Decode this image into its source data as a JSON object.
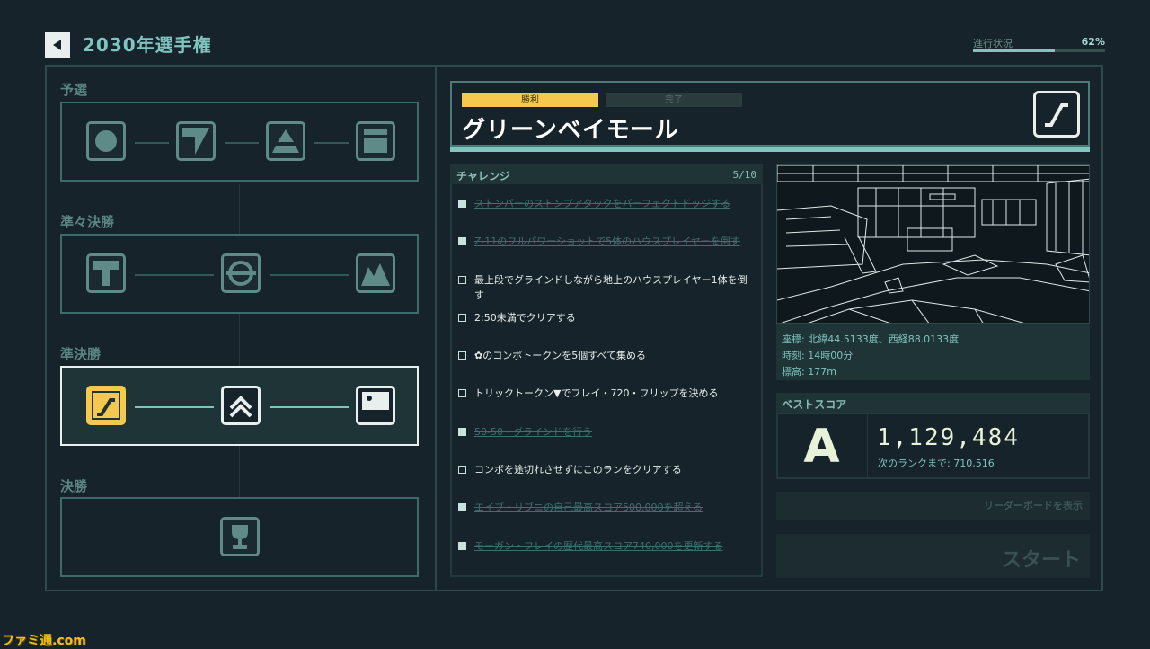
{
  "header": {
    "title": "2030年選手権",
    "progress_label": "進行状況",
    "progress_value": "62%",
    "progress_fraction": 0.62
  },
  "rounds": [
    {
      "label": "予選",
      "icons": [
        "circle-stage-icon",
        "slope-stage-icon",
        "pyramid-stage-icon",
        "box-stage-icon"
      ]
    },
    {
      "label": "準々決勝",
      "icons": [
        "hammer-stage-icon",
        "ring-stage-icon",
        "mountain-stage-icon"
      ]
    },
    {
      "label": "準決勝",
      "icons": [
        "stairs-stage-icon",
        "chevron-up-stage-icon",
        "screen-stage-icon"
      ]
    },
    {
      "label": "決勝",
      "icons": [
        "trophy-icon"
      ]
    }
  ],
  "location": {
    "badge_win": "勝利",
    "badge_done": "完了",
    "name": "グリーンベイモール",
    "icon": "stairs-icon"
  },
  "challenges": {
    "title": "チャレンジ",
    "count": "5/10",
    "items": [
      {
        "text": "ストンパーのストンプアタックをパーフェクトドッジする",
        "done": true
      },
      {
        "text": "Z-11のフルパワーショットで5体のハウスプレイヤーを倒す",
        "done": true
      },
      {
        "text": "最上段でグラインドしながら地上のハウスプレイヤー1体を倒す",
        "done": false
      },
      {
        "text": "2:50未満でクリアする",
        "done": false
      },
      {
        "text": "✿のコンボトークンを5個すべて集める",
        "done": false
      },
      {
        "text": "トリックトークン▼でフレイ・720・フリップを決める",
        "done": false
      },
      {
        "text": "50-50・グラインドを行う",
        "done": true
      },
      {
        "text": "コンボを途切れさせずにこのランをクリアする",
        "done": false
      },
      {
        "text": "エイブ・リブニの自己最高スコア500,000を超える",
        "done": true
      },
      {
        "text": "モーガン・フレイの歴代最高スコア740,000を更新する",
        "done": true
      }
    ]
  },
  "info": {
    "coords": "座標: 北緯44.5133度、西経88.0133度",
    "time": "時刻: 14時00分",
    "altitude": "標高: 177m"
  },
  "best_score": {
    "title": "ベストスコア",
    "rank": "A",
    "score": "1,129,484",
    "next_rank": "次のランクまで: 710,516"
  },
  "buttons": {
    "leaderboard": "リーダーボードを表示",
    "start": "スタート"
  },
  "watermark": "ファミ通.com",
  "colors": {
    "accent": "#7fc4be",
    "highlight": "#f4c94e",
    "background": "#16232a"
  }
}
